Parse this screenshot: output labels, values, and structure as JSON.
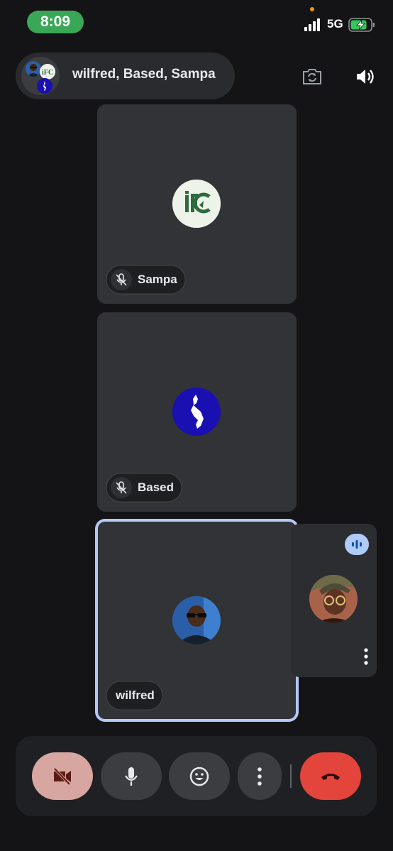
{
  "status_bar": {
    "time": "8:09",
    "network": "5G"
  },
  "call": {
    "title": "wilfred, Based, Sampa"
  },
  "participants": [
    {
      "name": "Sampa",
      "muted": true
    },
    {
      "name": "Based",
      "muted": true
    },
    {
      "name": "wilfred",
      "muted": false
    }
  ],
  "icons": {
    "flip_camera": "flip-camera-icon",
    "speaker": "speaker-icon",
    "camera_off": "camera-off-icon",
    "mic": "microphone-icon",
    "emoji": "emoji-icon",
    "more": "more-vert-icon",
    "end_call": "end-call-icon",
    "speaking": "audio-level-icon"
  },
  "colors": {
    "camera_off_button": "#d7a6a0",
    "end_call_button": "#e3443b",
    "active_tile_border": "#b4c7f5",
    "speaking_indicator": "#aecbfa"
  }
}
